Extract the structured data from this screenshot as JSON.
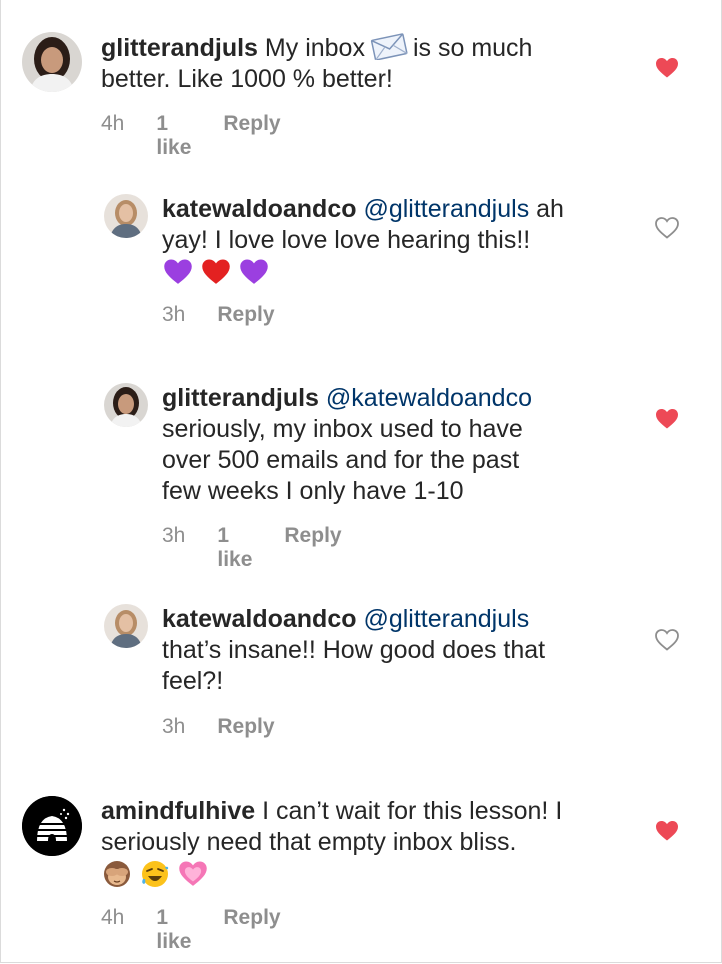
{
  "comments": [
    {
      "username": "glitterandjuls",
      "text_before_icon": "My inbox",
      "icon": "envelope-icon",
      "text_after_icon": "is so much",
      "text_line2": "better. Like 1000 % better!",
      "time": "4h",
      "likes": "1 like",
      "reply": "Reply",
      "liked": true
    },
    {
      "username": "katewaldoandco",
      "mention": "@glitterandjuls",
      "text_after_mention": "ah",
      "text_line2": "yay! I love love love hearing this!!",
      "emojis": [
        "purple-heart-icon",
        "red-heart-icon",
        "purple-heart-icon"
      ],
      "time": "3h",
      "reply": "Reply",
      "liked": false
    },
    {
      "username": "glitterandjuls",
      "mention": "@katewaldoandco",
      "text_line2": "seriously, my inbox used to have",
      "text_line3": "over 500 emails and for the past",
      "text_line4": "few weeks I only have 1-10",
      "time": "3h",
      "likes": "1 like",
      "reply": "Reply",
      "liked": true
    },
    {
      "username": "katewaldoandco",
      "mention": "@glitterandjuls",
      "text_line2": "that’s insane!! How good does that",
      "text_line3": "feel?!",
      "time": "3h",
      "reply": "Reply",
      "liked": false
    },
    {
      "username": "amindfulhive",
      "text_after_username": "I can’t wait for this lesson! I",
      "text_line2": "seriously need that empty inbox bliss.",
      "emojis": [
        "see-no-evil-monkey-icon",
        "rolling-laughing-icon",
        "growing-heart-icon"
      ],
      "time": "4h",
      "likes": "1 like",
      "reply": "Reply",
      "liked": true
    }
  ],
  "colors": {
    "heart_red": "#ed4956",
    "meta_gray": "#8e8e8e",
    "mention_blue": "#003569",
    "text": "#262626"
  }
}
